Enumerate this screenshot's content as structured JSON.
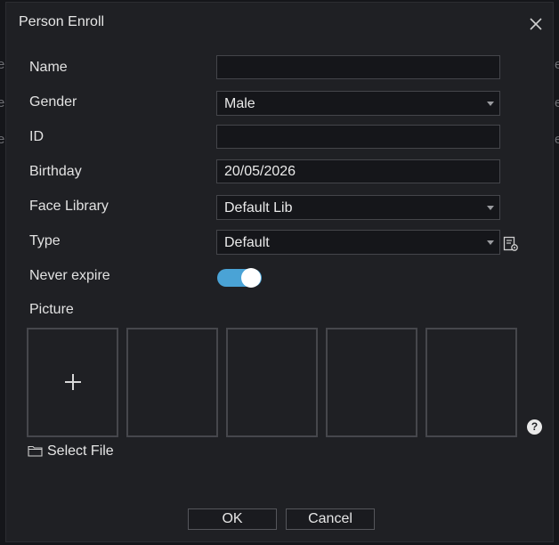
{
  "background": {
    "edge_glyphs": [
      "e",
      "e",
      "e",
      "e",
      "e",
      "e"
    ]
  },
  "dialog": {
    "title": "Person Enroll",
    "close_icon": "close-icon"
  },
  "form": {
    "name": {
      "label": "Name",
      "value": ""
    },
    "gender": {
      "label": "Gender",
      "value": "Male"
    },
    "id": {
      "label": "ID",
      "value": ""
    },
    "birthday": {
      "label": "Birthday",
      "value": "20/05/2026"
    },
    "face_library": {
      "label": "Face Library",
      "value": "Default Lib"
    },
    "type": {
      "label": "Type",
      "value": "Default",
      "manage_icon": "list-settings-icon"
    },
    "never_expire": {
      "label": "Never expire",
      "enabled": true
    },
    "picture": {
      "label": "Picture",
      "slots": 5,
      "add_icon": "plus-icon",
      "help_icon": "?"
    },
    "select_file": {
      "label": "Select File",
      "icon": "folder-icon"
    }
  },
  "footer": {
    "ok_label": "OK",
    "cancel_label": "Cancel"
  },
  "colors": {
    "dialog_bg": "#1f2024",
    "input_bg": "#15161a",
    "border": "#44454a",
    "toggle_on": "#4aa3d6",
    "text": "#e2e2e2"
  }
}
